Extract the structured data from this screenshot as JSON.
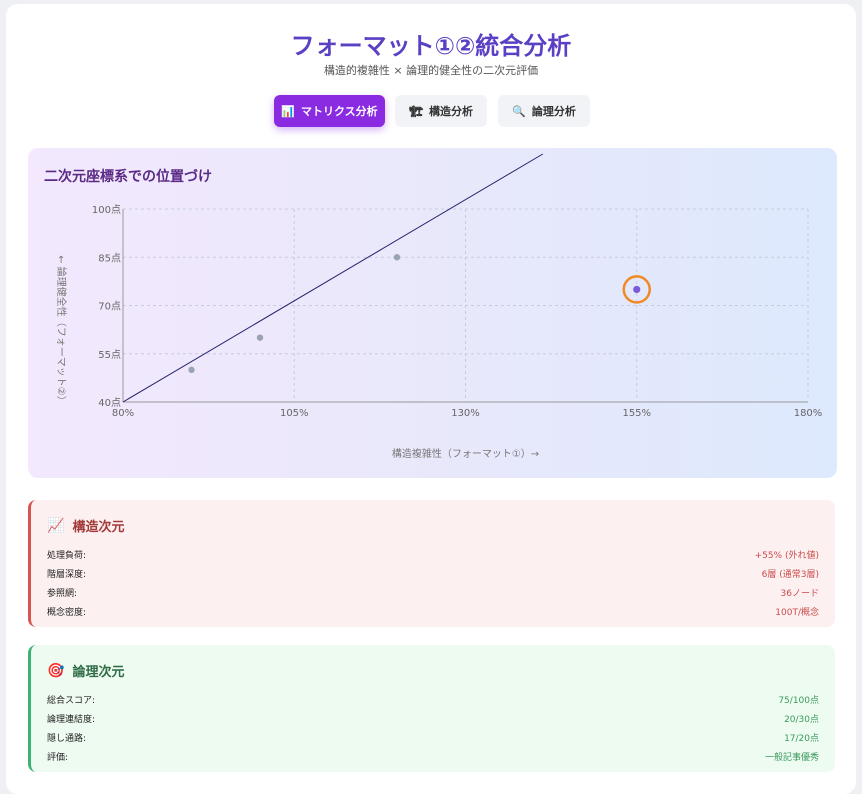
{
  "header": {
    "title": "フォーマット①②統合分析",
    "subtitle": "構造的複雑性 × 論理的健全性の二次元評価"
  },
  "tabs": [
    {
      "icon": "📊",
      "icon_name": "bar-chart-icon",
      "label": "マトリクス分析",
      "active": true
    },
    {
      "icon": "🏗",
      "icon_name": "construction-icon",
      "label": "構造分析",
      "active": false
    },
    {
      "icon": "🔍",
      "icon_name": "magnifier-icon",
      "label": "論理分析",
      "active": false
    }
  ],
  "chart": {
    "title": "二次元座標系での位置づけ"
  },
  "chart_data": {
    "type": "scatter",
    "xlabel": "構造複雑性（フォーマット①）→",
    "ylabel": "← 論理健全性（フォーマット②）",
    "xlim": [
      80,
      180
    ],
    "ylim": [
      40,
      100
    ],
    "x_ticks": [
      "80%",
      "105%",
      "130%",
      "155%",
      "180%"
    ],
    "y_ticks": [
      "40点",
      "55点",
      "70点",
      "85点",
      "100点"
    ],
    "x_tick_values": [
      80,
      105,
      130,
      155,
      180
    ],
    "y_tick_values": [
      40,
      55,
      70,
      85,
      100
    ],
    "grid": true,
    "points": [
      {
        "x": 90,
        "y": 50
      },
      {
        "x": 100,
        "y": 60
      },
      {
        "x": 120,
        "y": 85
      }
    ],
    "highlight": {
      "x": 155,
      "y": 75
    },
    "trend_line": [
      {
        "x": 80,
        "y": 40
      },
      {
        "x": 142,
        "y": 118
      }
    ],
    "colors": {
      "point": "#9aa3b5",
      "highlight_point": "#7b5cd6",
      "highlight_ring": "#f08a24",
      "trend_line": "#23236b",
      "grid": "#c9cbe0"
    }
  },
  "structure_panel": {
    "icon": "📈",
    "icon_name": "chart-increasing-icon",
    "title": "構造次元",
    "rows": [
      {
        "label": "処理負荷:",
        "value": "+55% (外れ値)"
      },
      {
        "label": "階層深度:",
        "value": "6層 (通常3層)"
      },
      {
        "label": "参照網:",
        "value": "36ノード"
      },
      {
        "label": "概念密度:",
        "value": "100T/概念"
      }
    ]
  },
  "logic_panel": {
    "icon": "🎯",
    "icon_name": "target-icon",
    "title": "論理次元",
    "rows": [
      {
        "label": "総合スコア:",
        "value": "75/100点"
      },
      {
        "label": "論理連結度:",
        "value": "20/30点"
      },
      {
        "label": "隠し通路:",
        "value": "17/20点"
      },
      {
        "label": "評価:",
        "value": "一般記事優秀"
      }
    ]
  }
}
